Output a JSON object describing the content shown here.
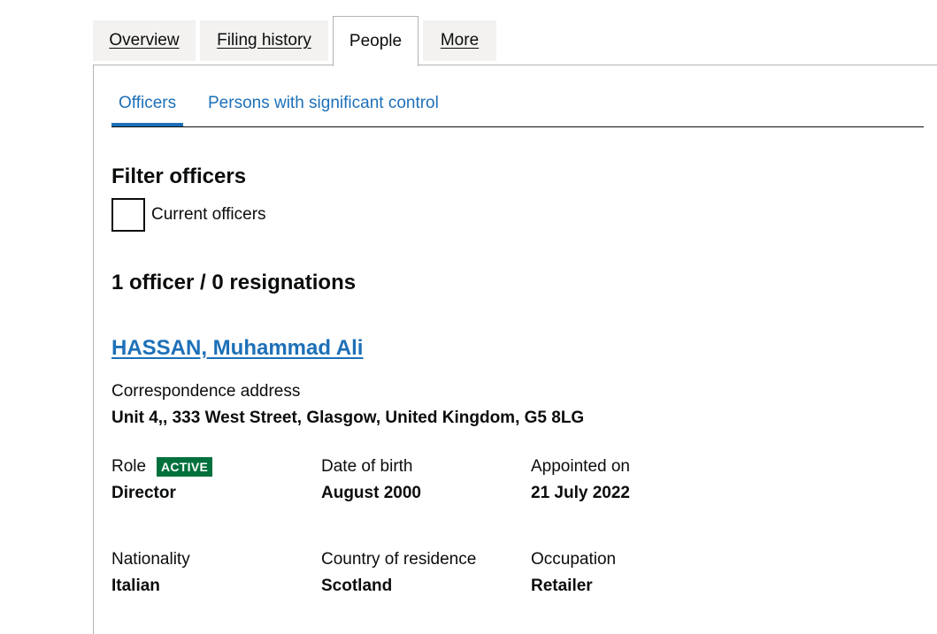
{
  "tabs": [
    {
      "label": "Overview"
    },
    {
      "label": "Filing history"
    },
    {
      "label": "People"
    },
    {
      "label": "More"
    }
  ],
  "subtabs": [
    {
      "label": "Officers"
    },
    {
      "label": "Persons with significant control"
    }
  ],
  "filter": {
    "heading": "Filter officers",
    "checkbox_label": "Current officers"
  },
  "summary": "1 officer / 0 resignations",
  "officer": {
    "name": "HASSAN, Muhammad Ali",
    "address_label": "Correspondence address",
    "address": "Unit 4,, 333 West Street, Glasgow, United Kingdom, G5 8LG",
    "role_label": "Role",
    "status_badge": "ACTIVE",
    "role": "Director",
    "dob_label": "Date of birth",
    "dob": "August 2000",
    "appointed_label": "Appointed on",
    "appointed": "21 July 2022",
    "nationality_label": "Nationality",
    "nationality": "Italian",
    "residence_label": "Country of residence",
    "residence": "Scotland",
    "occupation_label": "Occupation",
    "occupation": "Retailer"
  },
  "colors": {
    "link": "#1d70b8",
    "badge_bg": "#00703c",
    "tab_bg": "#f3f2f1",
    "text": "#0b0c0c"
  }
}
